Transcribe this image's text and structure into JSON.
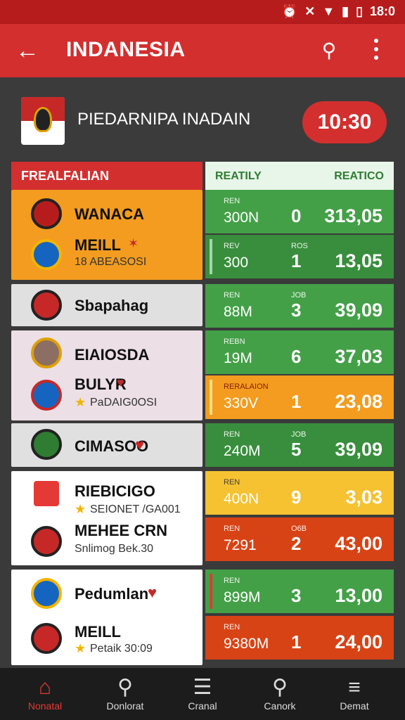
{
  "status": {
    "icons": [
      "alarm-icon",
      "vibrate-icon",
      "wifi-icon",
      "signal-icon",
      "battery-icon"
    ],
    "time": "18:0"
  },
  "appbar": {
    "title": "INDANESIA"
  },
  "team_header": {
    "name": "PIEDARNIPA INADAIN",
    "time": "10:30"
  },
  "table_header": {
    "left": "FREALFALIAN",
    "right_a": "REATILY",
    "right_b": "REATICO"
  },
  "matches": [
    {
      "teams": [
        {
          "name": "WANACA",
          "sub": ""
        },
        {
          "name": "MEILL",
          "sub": "18 ABEASOSI"
        }
      ],
      "odds": [
        {
          "label": "REN",
          "amount": "300N",
          "small": "",
          "num": "0",
          "value": "313,05"
        },
        {
          "label": "REV",
          "amount": "300",
          "small": "ROS",
          "num": "1",
          "value": "13,05"
        }
      ]
    },
    {
      "teams": [
        {
          "name": "Sbapahag",
          "sub": ""
        }
      ],
      "odds": [
        {
          "label": "REN",
          "amount": "88M",
          "small": "JOB",
          "num": "3",
          "value": "39,09"
        }
      ]
    },
    {
      "teams": [
        {
          "name": "EIAIOSDA",
          "sub": ""
        },
        {
          "name": "BULYR",
          "sub": "PaDAIG0OSI"
        }
      ],
      "odds": [
        {
          "label": "REBN",
          "amount": "19M",
          "small": "",
          "num": "6",
          "value": "37,03"
        },
        {
          "label": "RERALAION",
          "amount": "330V",
          "small": "",
          "num": "1",
          "value": "23,08"
        }
      ]
    },
    {
      "teams": [
        {
          "name": "CIMASOO",
          "sub": ""
        }
      ],
      "odds": [
        {
          "label": "REN",
          "amount": "240M",
          "small": "JOB",
          "num": "5",
          "value": "39,09"
        }
      ]
    },
    {
      "teams": [
        {
          "name": "RIEBICIGO",
          "sub": "SEIONET /GA001"
        },
        {
          "name": "MEHEE CRN",
          "sub": "Snlimog Bek.30"
        }
      ],
      "odds": [
        {
          "label": "REN",
          "amount": "400N",
          "small": "",
          "num": "9",
          "value": "3,03"
        },
        {
          "label": "REN",
          "amount": "7291",
          "small": "O6B",
          "num": "2",
          "value": "43,00"
        }
      ]
    },
    {
      "teams": [
        {
          "name": "Pedumlan",
          "sub": ""
        },
        {
          "name": "MEILL",
          "sub": "Petaik 30:09"
        }
      ],
      "odds": [
        {
          "label": "REN",
          "amount": "899M",
          "small": "",
          "num": "3",
          "value": "13,00"
        },
        {
          "label": "REN",
          "amount": "9380M",
          "small": "",
          "num": "1",
          "value": "24,00"
        }
      ]
    }
  ],
  "nav": [
    {
      "label": "Nonatal",
      "icon": "home-icon"
    },
    {
      "label": "Donlorat",
      "icon": "search-icon"
    },
    {
      "label": "Cranal",
      "icon": "list-icon"
    },
    {
      "label": "Canork",
      "icon": "search-icon"
    },
    {
      "label": "Demat",
      "icon": "menu-icon"
    }
  ]
}
